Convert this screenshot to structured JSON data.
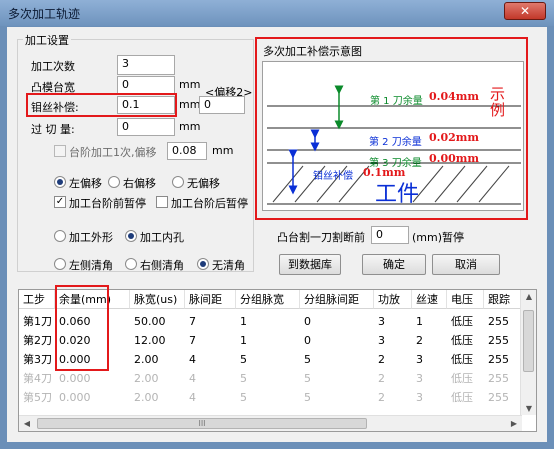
{
  "window": {
    "title": "多次加工轨迹",
    "close_symbol": "✕"
  },
  "settings": {
    "group_label": "加工设置",
    "passes_label": "加工次数",
    "passes_value": "3",
    "die_width_label": "凸模台宽",
    "die_width_value": "0",
    "die_width_unit": "mm",
    "offset2_label": "<偏移2>",
    "offset2_value": "0",
    "wire_comp_label": "钼丝补偿:",
    "wire_comp_value": "0.1",
    "wire_comp_unit": "mm",
    "overcut_label": "过 切 量:",
    "overcut_value": "0",
    "overcut_unit": "mm",
    "step_label": "台阶加工1次,偏移",
    "step_value": "0.08",
    "step_unit": "mm",
    "offset_left": "左偏移",
    "offset_right": "右偏移",
    "offset_none": "无偏移",
    "pause_before": "加工台阶前暂停",
    "pause_after": "加工台阶后暂停"
  },
  "diagram": {
    "group_label": "多次加工补偿示意图",
    "pass1": "第 1 刀余量",
    "pass1_value": "0.04mm",
    "pass2": "第 2 刀余量",
    "pass2_value": "0.02mm",
    "pass3": "第 3 刀余量",
    "pass3_value": "0.00mm",
    "wire": "钼丝补偿",
    "wire_value": "0.1mm",
    "workpiece": "工件",
    "example_mark": "示例"
  },
  "mode": {
    "outer": "加工外形",
    "inner": "加工内孔"
  },
  "corner": {
    "left": "左侧清角",
    "right": "右侧清角",
    "none": "无清角"
  },
  "boss": {
    "label": "凸台割一刀割断前",
    "value": "0",
    "suffix": "(mm)暂停"
  },
  "buttons": {
    "db": "到数据库",
    "ok": "确定",
    "cancel": "取消"
  },
  "table": {
    "headers": [
      "工步",
      "余量(mm)",
      "脉宽(us)",
      "脉间距",
      "分组脉宽",
      "分组脉间距",
      "功放",
      "丝速",
      "电压",
      "跟踪"
    ],
    "rows": [
      [
        "第1刀",
        "0.060",
        "50.00",
        "7",
        "1",
        "0",
        "3",
        "1",
        "低压",
        "255"
      ],
      [
        "第2刀",
        "0.020",
        "12.00",
        "7",
        "1",
        "0",
        "3",
        "2",
        "低压",
        "255"
      ],
      [
        "第3刀",
        "0.000",
        "2.00",
        "4",
        "5",
        "5",
        "2",
        "3",
        "低压",
        "255"
      ],
      [
        "第4刀",
        "0.000",
        "2.00",
        "4",
        "5",
        "5",
        "2",
        "3",
        "低压",
        "255"
      ],
      [
        "第5刀",
        "0.000",
        "2.00",
        "4",
        "5",
        "5",
        "2",
        "3",
        "低压",
        "255"
      ]
    ],
    "scroll_symbol": "III"
  },
  "colors": {
    "highlight_red": "#e3191b",
    "pass_green": "#0a8a2a",
    "pass_blue": "#0a2fd6",
    "value_red": "#e3191b"
  }
}
